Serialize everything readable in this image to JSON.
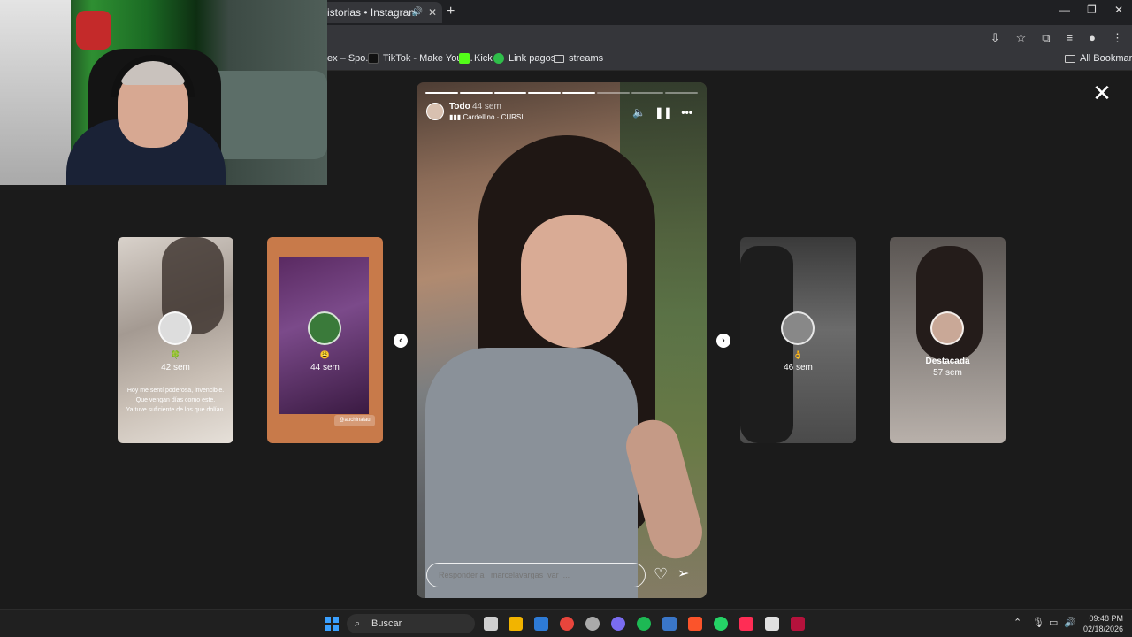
{
  "browser": {
    "tab_title": "istorias • Instagram",
    "bookmarks": [
      {
        "label": "ex – Spo..."
      },
      {
        "label": "TikTok - Make Your..."
      },
      {
        "label": "Kick"
      },
      {
        "label": "Link pagos"
      },
      {
        "label": "streams"
      }
    ],
    "all_bookmarks": "All Bookmarks"
  },
  "stories": {
    "side_cards": [
      {
        "age": "42 sem",
        "caption": [
          "Hoy me sentí poderosa, invencible.",
          "Que vengan días como este.",
          "Ya tuve suficiente de los que dolían."
        ]
      },
      {
        "age": "44 sem",
        "tag": "@auchinalau"
      },
      {
        "age": "46 sem"
      },
      {
        "label": "Destacada",
        "age": "57 sem"
      }
    ],
    "main": {
      "username": "Todo",
      "time": "44 sem",
      "music": "Cardellino · CURSI",
      "reply_placeholder": "Responder a _marcelavargas_var_...",
      "progress_done": 5,
      "progress_total": 8
    }
  },
  "taskbar": {
    "search_label": "Buscar",
    "time": "09:48 PM",
    "date": "02/18/2026",
    "icon_colors": [
      "#f2b400",
      "#2e7bd6",
      "#e8453c",
      "#aaaaaa",
      "#7a6cf0",
      "#1db954",
      "#3a76c8",
      "#fb542b",
      "#25d366",
      "#ff2d55",
      "#e0e0e0",
      "#b5123c"
    ]
  }
}
